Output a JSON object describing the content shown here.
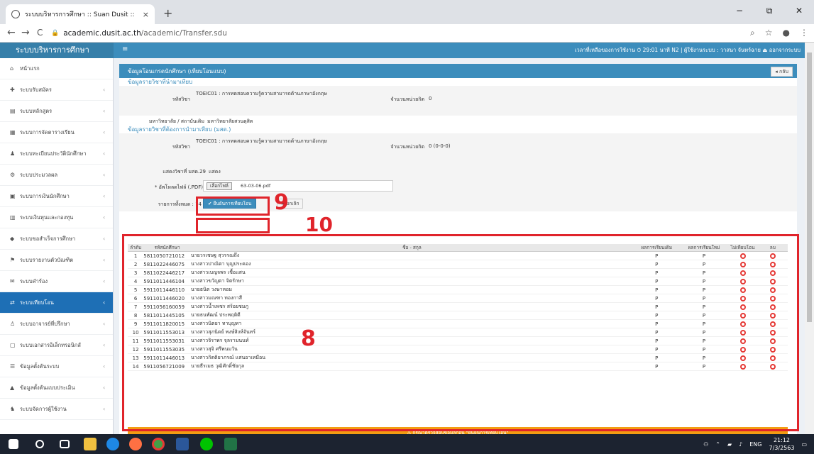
{
  "browser": {
    "tab_title": "ระบบบริหารการศึกษา :: Suan Dusit ::",
    "tab_close": "×",
    "new_tab": "+",
    "url_domain": "academic.dusit.ac.th",
    "url_path": "/academic/Transfer.sdu",
    "back": "←",
    "forward": "→",
    "reload": "C",
    "minimize": "−",
    "maximize": "⧉",
    "close": "✕"
  },
  "app": {
    "brand": "ระบบบริหารการศึกษา",
    "menu_toggle": "≡",
    "user_info": "เวลาที่เหลือของการใช้งาน ⏱ 29:01 นาที  N2  |  ผู้ใช้งานระบบ : วาสนา จันทร์ฉาย  ⏏ ออกจากระบบ"
  },
  "sidebar": {
    "items": [
      {
        "label": "หน้าแรก",
        "icon": "home-icon"
      },
      {
        "label": "ระบบรับสมัคร",
        "icon": "user-plus-icon"
      },
      {
        "label": "ระบบหลักสูตร",
        "icon": "book-icon"
      },
      {
        "label": "ระบบการจัดตารางเรียน",
        "icon": "calendar-icon"
      },
      {
        "label": "ระบบทะเบียนประวัตินักศึกษา",
        "icon": "user-icon"
      },
      {
        "label": "ระบบประมวลผล",
        "icon": "cogs-icon"
      },
      {
        "label": "ระบบการเงินนักศึกษา",
        "icon": "money-icon"
      },
      {
        "label": "ระบบเงินทุนและกองทุน",
        "icon": "bank-icon"
      },
      {
        "label": "ระบบขอสำเร็จการศึกษา",
        "icon": "graduate-icon"
      },
      {
        "label": "ระบบรายงานตัวบัณฑิต",
        "icon": "flag-icon"
      },
      {
        "label": "ระบบคำร้อง",
        "icon": "envelope-icon"
      },
      {
        "label": "ระบบเทียบโอน",
        "icon": "exchange-icon",
        "active": true
      },
      {
        "label": "ระบบอาจารย์ที่ปรึกษา",
        "icon": "teacher-icon"
      },
      {
        "label": "ระบบเอกสารอิเล็กทรอนิกส์",
        "icon": "file-icon"
      },
      {
        "label": "ข้อมูลตั้งต้นระบบ",
        "icon": "list-icon"
      },
      {
        "label": "ข้อมูลตั้งต้นแบบประเมิน",
        "icon": "chart-icon"
      },
      {
        "label": "ระบบจัดการผู้ใช้งาน",
        "icon": "users-icon"
      }
    ]
  },
  "content": {
    "header": "ข้อมูลโอนเกรดนักศึกษา (เทียบโอนแบบ)",
    "back_label": "◂ กลับ",
    "section1": "ข้อมูลรายวิชาที่นำมาเทียบ",
    "subject_label": "รหัสวิชา",
    "subject_value": "TOEIC01 : การทดสอบความรู้ความสามารถด้านภาษาอังกฤษ",
    "credits_label": "จำนวนหน่วยกิต",
    "credits_value": "0",
    "university_label": "มหาวิทยาลัย / สถาบันเดิม",
    "university_value": "มหาวิทยาลัยสวนดุสิต",
    "section2": "ข้อมูลรายวิชาที่ต้องการนำมาเทียบ (มสด.)",
    "subject2_label": "รหัสวิชา",
    "subject2_value": "TOEIC01 : การทดสอบความรู้ความสามารถด้านภาษาอังกฤษ",
    "credits2_label": "จำนวนหน่วยกิต",
    "credits2_value": "0 (0-0-0)",
    "show_label": "แสดงวิชาที่ มสด.29",
    "show_value": "แสดง",
    "file_label": "* อัพโหลดไฟล์ (.PDF)",
    "file_button": "เลือกไฟล์",
    "file_name": "63-03-06.pdf",
    "count_label": "รายการทั้งหมด : 14",
    "confirm_button": "✔ ยืนยันการเทียบโอน",
    "cancel_button": "✖ ยกเลิก",
    "warning": "⚠ กรุณาตรวจสอบข้อมูลก่อน \"ยืนยันการเทียบโอน\""
  },
  "table": {
    "headers": [
      "ลำดับ",
      "รหัสนักศึกษา",
      "ชื่อ - สกุล",
      "ผลการเรียนเดิม",
      "ผลการเรียนใหม่",
      "ไม่เทียบโอน",
      "ลบ"
    ],
    "rows": [
      [
        "1",
        "5811050721012",
        "นายวรเชษฐ สุวรรณถึง",
        "P",
        "P"
      ],
      [
        "2",
        "5811022446075",
        "นางสาวปาณิตา บุญประคอง",
        "P",
        "P"
      ],
      [
        "3",
        "5811022446217",
        "นางสาวเบญจพร เชื้อแสน",
        "P",
        "P"
      ],
      [
        "4",
        "5911011446104",
        "นางสาวขวัญตา จิตรักษา",
        "P",
        "P"
      ],
      [
        "5",
        "5911011446110",
        "นายธนิต วงษาหอม",
        "P",
        "P"
      ],
      [
        "6",
        "5911011446020",
        "นางสาวมณฑา ทองกาสี",
        "P",
        "P"
      ],
      [
        "7",
        "5911056160059",
        "นางสาวน้ำเพชร สร้อยชมภู",
        "P",
        "P"
      ],
      [
        "8",
        "5811011445105",
        "นายธนพัฒน์ ประพฤติดี",
        "P",
        "P"
      ],
      [
        "9",
        "5911011820015",
        "นางสาวนิตยา ทาบุญทา",
        "P",
        "P"
      ],
      [
        "10",
        "5911011553013",
        "นางสาวสุภนิตย์ พงษ์สิงห์จันทร์",
        "P",
        "P"
      ],
      [
        "11",
        "5911011553031",
        "นางสาวจิราพร จุลรามนนท์",
        "P",
        "P"
      ],
      [
        "12",
        "5911011553035",
        "นางสาวสุจิ ศรีพนมวัน",
        "P",
        "P"
      ],
      [
        "13",
        "5911011446013",
        "นางสาวกิตติยาภรณ์ แสนอาเหมือน",
        "P",
        "P"
      ],
      [
        "14",
        "5911056721009",
        "นายธีรเมธ วุฒิศักดิ์ชัยกุล",
        "P",
        "P"
      ]
    ]
  },
  "annotations": {
    "a8": "8",
    "a9": "9",
    "a10": "10"
  },
  "taskbar": {
    "lang": "ENG",
    "time": "21:12",
    "date": "7/3/2563"
  }
}
